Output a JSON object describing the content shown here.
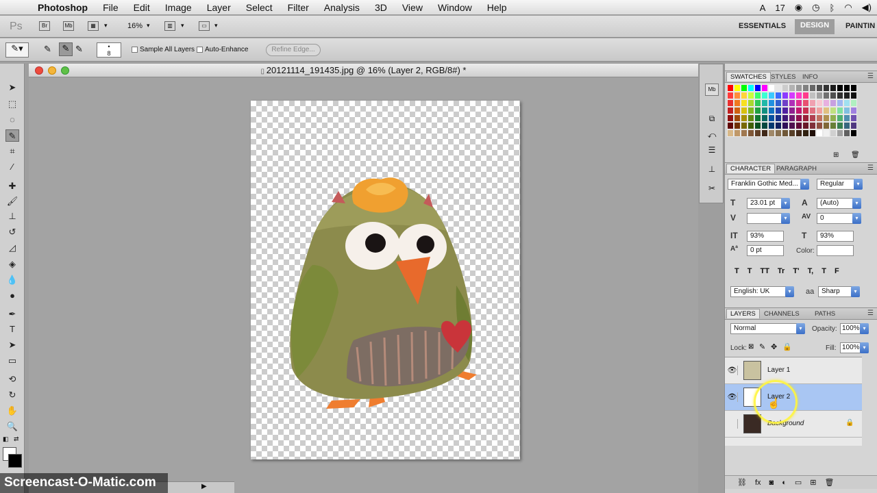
{
  "menubar": {
    "app_name": "Photoshop",
    "items": [
      "File",
      "Edit",
      "Image",
      "Layer",
      "Select",
      "Filter",
      "Analysis",
      "3D",
      "View",
      "Window",
      "Help"
    ],
    "status_text": "17"
  },
  "appbar": {
    "zoom": "16%",
    "workspaces": [
      "ESSENTIALS",
      "DESIGN",
      "PAINTIN"
    ],
    "active_workspace": "DESIGN"
  },
  "options": {
    "brush_size": "8",
    "sample_all_layers": "Sample All Layers",
    "auto_enhance": "Auto-Enhance",
    "refine_edge": "Refine Edge..."
  },
  "document": {
    "title": "20121114_191435.jpg @ 16% (Layer 2, RGB/8#) *"
  },
  "swatches_panel": {
    "tabs": [
      "SWATCHES",
      "STYLES",
      "INFO"
    ],
    "colors": [
      "#ff0000",
      "#ffff00",
      "#00ff00",
      "#00ffff",
      "#0000ff",
      "#ff00ff",
      "#ffffff",
      "#e6e6e6",
      "#cccccc",
      "#b3b3b3",
      "#999999",
      "#808080",
      "#666666",
      "#4d4d4d",
      "#333333",
      "#1a1a1a",
      "#000000",
      "#000000",
      "#000000",
      "#ff3b3b",
      "#ff8c3b",
      "#ffd43b",
      "#c8ff3b",
      "#3bff6b",
      "#3bffd4",
      "#3bc8ff",
      "#3b6bff",
      "#8c3bff",
      "#d43bff",
      "#ff3bc8",
      "#ff3b8c",
      "#c0c0c0",
      "#a0a0a0",
      "#707070",
      "#505050",
      "#303030",
      "#202020",
      "#101010",
      "#e83030",
      "#f07820",
      "#f8e020",
      "#a8d830",
      "#30c858",
      "#20b8a8",
      "#2090e0",
      "#3060d0",
      "#7040c8",
      "#b030b8",
      "#e03090",
      "#e85070",
      "#f0a0b0",
      "#f8c8d0",
      "#e8b0e0",
      "#c8a0e0",
      "#a0b8f0",
      "#a0e0f0",
      "#b0f0c0",
      "#c02020",
      "#d06010",
      "#d8c010",
      "#80b820",
      "#20a040",
      "#109080",
      "#1070c0",
      "#2040b0",
      "#5020a0",
      "#902090",
      "#c01870",
      "#c83050",
      "#e07080",
      "#f0a0a0",
      "#e0c080",
      "#c0e080",
      "#80e0a0",
      "#80c0e0",
      "#a080e0",
      "#901010",
      "#a04808",
      "#a89008",
      "#608810",
      "#107830",
      "#086860",
      "#0850a0",
      "#183088",
      "#401878",
      "#701870",
      "#901050",
      "#982038",
      "#b04050",
      "#c07060",
      "#b09050",
      "#90b050",
      "#50b070",
      "#5090b0",
      "#7050b0",
      "#600808",
      "#703004",
      "#786804",
      "#406008",
      "#085020",
      "#044840",
      "#043870",
      "#102060",
      "#301058",
      "#501050",
      "#600838",
      "#681828",
      "#803038",
      "#905040",
      "#806838",
      "#688038",
      "#388050",
      "#386880",
      "#503880",
      "#d8b888",
      "#c09868",
      "#a07850",
      "#805838",
      "#604028",
      "#402818",
      "#a08868",
      "#887050",
      "#705838",
      "#584028",
      "#402818",
      "#302010",
      "#201008",
      "#ffffff",
      "#f0f0f0",
      "#d0d0d0",
      "#a0a0a0",
      "#606060",
      "#000000"
    ]
  },
  "character_panel": {
    "tabs": [
      "CHARACTER",
      "PARAGRAPH"
    ],
    "font_family": "Franklin Gothic Med...",
    "font_style": "Regular",
    "font_size": "23.01 pt",
    "leading": "(Auto)",
    "kerning": "",
    "tracking": "0",
    "vertical_scale": "93%",
    "horizontal_scale": "93%",
    "baseline_shift": "0 pt",
    "color_label": "Color:",
    "style_buttons": [
      "T",
      "T",
      "TT",
      "Tr",
      "T'",
      "T,",
      "T",
      "F"
    ],
    "language": "English: UK",
    "antialias_label": "aa",
    "antialias": "Sharp"
  },
  "layers_panel": {
    "tabs": [
      "LAYERS",
      "CHANNELS",
      "PATHS"
    ],
    "blend_mode": "Normal",
    "opacity_label": "Opacity:",
    "opacity": "100%",
    "lock_label": "Lock:",
    "fill_label": "Fill:",
    "fill": "100%",
    "layers": [
      {
        "name": "Layer 1",
        "visible": true,
        "selected": false
      },
      {
        "name": "Layer 2",
        "visible": true,
        "selected": true
      },
      {
        "name": "Background",
        "visible": false,
        "selected": false,
        "locked": true
      }
    ]
  },
  "watermark": "Screencast-O-Matic.com"
}
